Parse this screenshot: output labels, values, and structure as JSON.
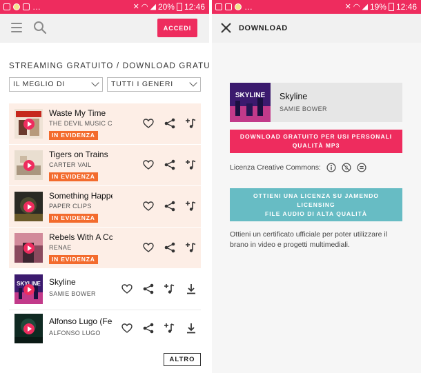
{
  "left_status": {
    "percent": "20%",
    "time": "12:46"
  },
  "right_status": {
    "percent": "19%",
    "time": "12:46"
  },
  "colors": {
    "accent": "#ee2c5e",
    "featured_bg": "#fdeee6",
    "badge": "#f36b2d",
    "teal": "#67bcc4"
  },
  "header": {
    "login_label": "ACCEDI"
  },
  "section_title": "STREAMING GRATUITO / DOWNLOAD GRATUITO",
  "filters": {
    "best": "IL MEGLIO DI",
    "genres": "TUTTI I GENERI"
  },
  "tracks": [
    {
      "title": "Waste My Time",
      "artist": "THE DEVIL MUSIC CO",
      "badge": "IN EVIDENZA"
    },
    {
      "title": "Tigers on Trains",
      "artist": "CARTER VAIL",
      "badge": "IN EVIDENZA"
    },
    {
      "title": "Something Happe",
      "artist": "PAPER CLIPS",
      "badge": "IN EVIDENZA"
    },
    {
      "title": "Rebels With A Cc",
      "artist": "RENAE",
      "badge": "IN EVIDENZA"
    },
    {
      "title": "Skyline",
      "artist": "SAMIE BOWER"
    },
    {
      "title": "Alfonso Lugo (Fec",
      "artist": "ALFONSO LUGO"
    }
  ],
  "more_label": "ALTRO",
  "download": {
    "title": "DOWNLOAD",
    "track_title": "Skyline",
    "track_artist": "SAMIE BOWER",
    "cover_text": "SKYLINE",
    "free_download_line1": "DOWNLOAD GRATUITO PER USI PERSONALI",
    "free_download_line2": "QUALITÀ MP3",
    "license_label": "Licenza Creative Commons:",
    "license_btn_line1": "OTTIENI UNA LICENZA SU JAMENDO",
    "license_btn_line2": "LICENSING",
    "license_btn_line3": "FILE AUDIO DI ALTA QUALITÀ",
    "description": "Ottieni un certificato ufficiale per poter utilizzare il brano in video e progetti multimediali."
  }
}
